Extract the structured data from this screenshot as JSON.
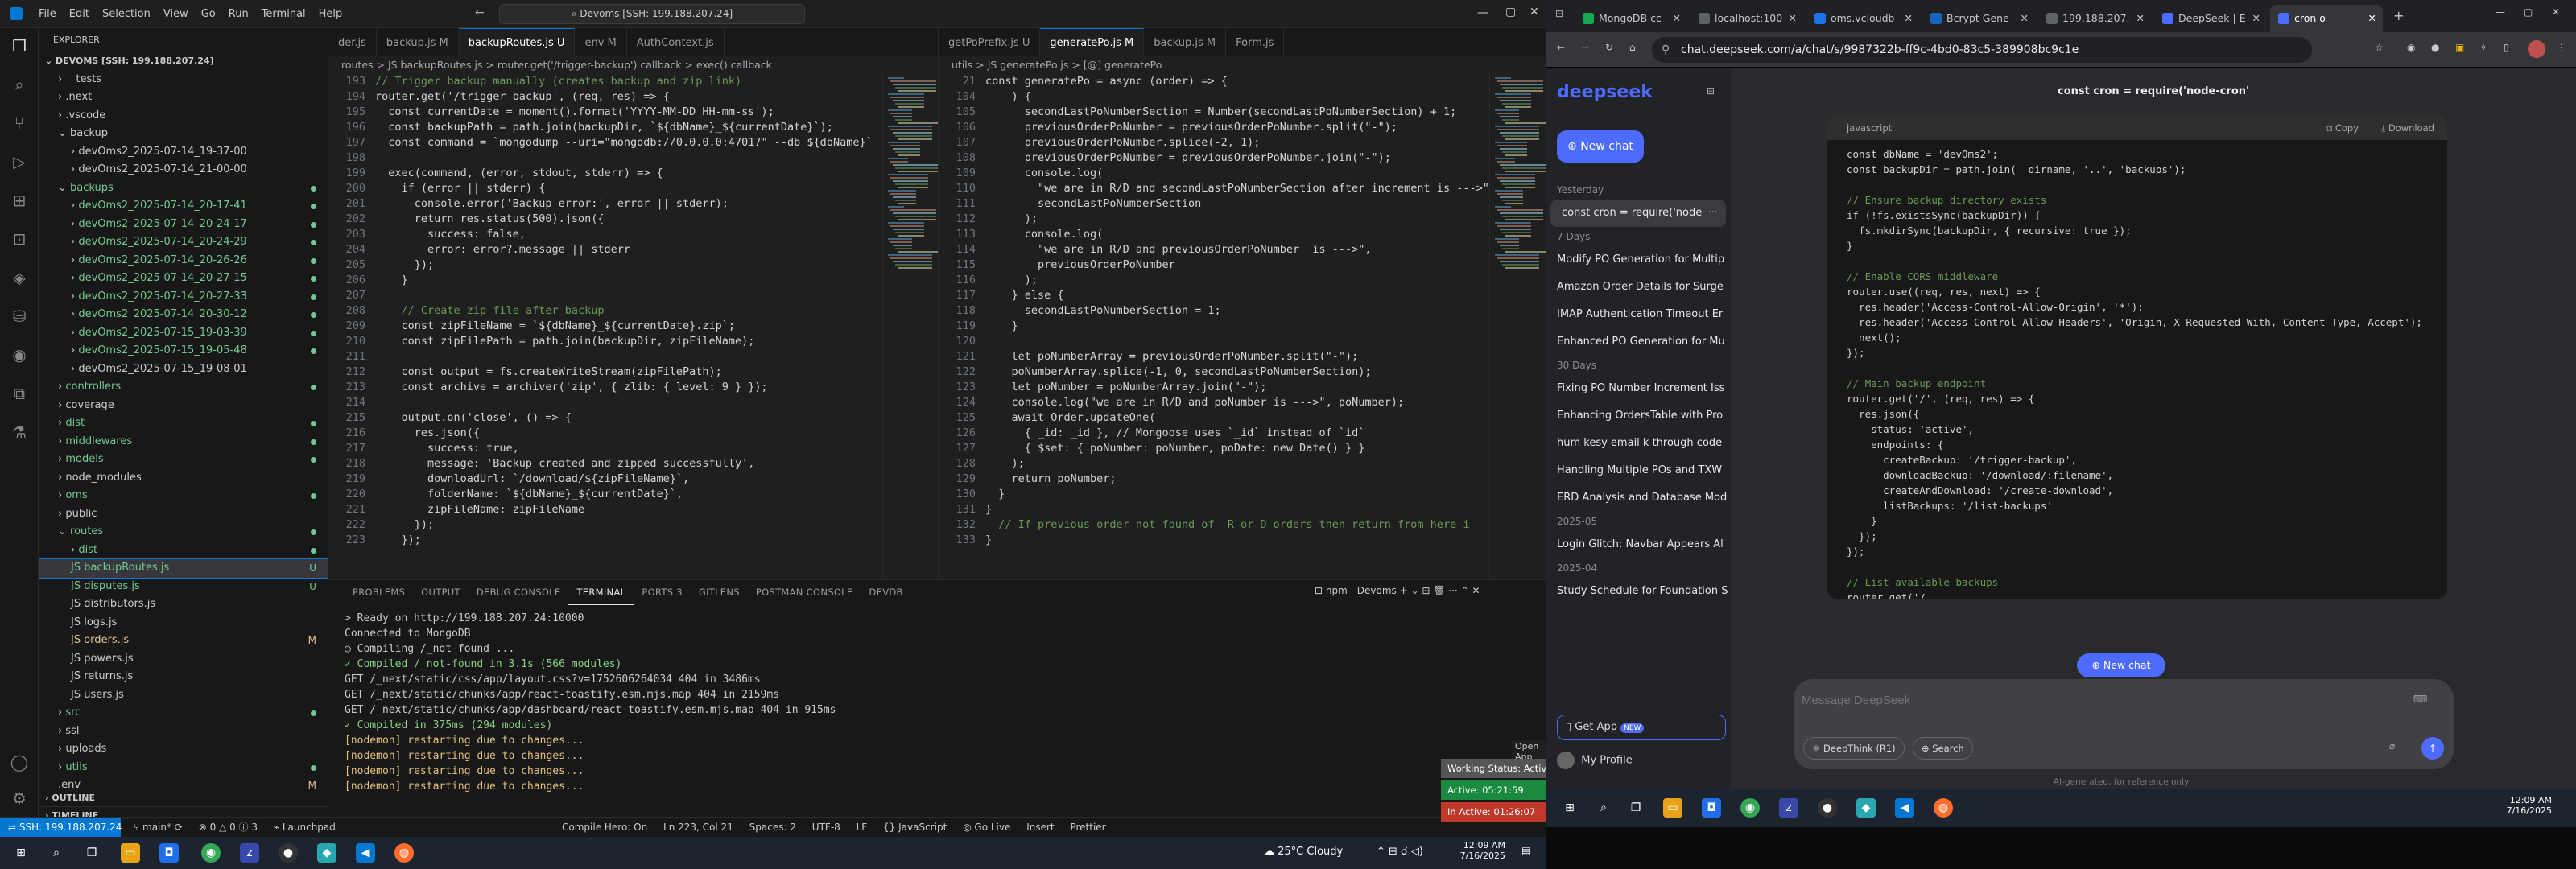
{
  "vscode": {
    "menu": [
      "File",
      "Edit",
      "Selection",
      "View",
      "Go",
      "Run",
      "Terminal",
      "Help"
    ],
    "command_center": "Devoms [SSH: 199.188.207.24]",
    "explorer_title": "EXPLORER",
    "workspace": "DEVOMS [SSH: 199.188.207.24]",
    "tree": [
      {
        "label": "__tests__",
        "indent": 1,
        "arrow": ">"
      },
      {
        "label": ".next",
        "indent": 1,
        "arrow": ">"
      },
      {
        "label": ".vscode",
        "indent": 1,
        "arrow": ">"
      },
      {
        "label": "backup",
        "indent": 1,
        "arrow": "v"
      },
      {
        "label": "devOms2_2025-07-14_19-37-00",
        "indent": 2,
        "arrow": ">"
      },
      {
        "label": "devOms2_2025-07-14_21-00-00",
        "indent": 2,
        "arrow": ">"
      },
      {
        "label": "backups",
        "indent": 1,
        "arrow": "v",
        "dot": true
      },
      {
        "label": "devOms2_2025-07-14_20-17-41",
        "indent": 2,
        "arrow": ">",
        "dot": true
      },
      {
        "label": "devOms2_2025-07-14_20-24-17",
        "indent": 2,
        "arrow": ">",
        "dot": true
      },
      {
        "label": "devOms2_2025-07-14_20-24-29",
        "indent": 2,
        "arrow": ">",
        "dot": true
      },
      {
        "label": "devOms2_2025-07-14_20-26-26",
        "indent": 2,
        "arrow": ">",
        "dot": true
      },
      {
        "label": "devOms2_2025-07-14_20-27-15",
        "indent": 2,
        "arrow": ">",
        "dot": true
      },
      {
        "label": "devOms2_2025-07-14_20-27-33",
        "indent": 2,
        "arrow": ">",
        "dot": true
      },
      {
        "label": "devOms2_2025-07-14_20-30-12",
        "indent": 2,
        "arrow": ">",
        "dot": true
      },
      {
        "label": "devOms2_2025-07-15_19-03-39",
        "indent": 2,
        "arrow": ">",
        "dot": true
      },
      {
        "label": "devOms2_2025-07-15_19-05-48",
        "indent": 2,
        "arrow": ">",
        "dot": true
      },
      {
        "label": "devOms2_2025-07-15_19-08-01",
        "indent": 2,
        "arrow": ">"
      },
      {
        "label": "controllers",
        "indent": 1,
        "arrow": ">",
        "dot": true
      },
      {
        "label": "coverage",
        "indent": 1,
        "arrow": ">"
      },
      {
        "label": "dist",
        "indent": 1,
        "arrow": ">",
        "dot": true
      },
      {
        "label": "middlewares",
        "indent": 1,
        "arrow": ">",
        "dot": true
      },
      {
        "label": "models",
        "indent": 1,
        "arrow": ">",
        "dot": true
      },
      {
        "label": "node_modules",
        "indent": 1,
        "arrow": ">"
      },
      {
        "label": "oms",
        "indent": 1,
        "arrow": ">",
        "dot": true
      },
      {
        "label": "public",
        "indent": 1,
        "arrow": ">"
      },
      {
        "label": "routes",
        "indent": 1,
        "arrow": "v",
        "dot": true
      },
      {
        "label": "dist",
        "indent": 2,
        "arrow": ">",
        "dot": true
      },
      {
        "label": "JS backupRoutes.js",
        "indent": 2,
        "arrow": "",
        "badge": "U",
        "sel": true
      },
      {
        "label": "JS disputes.js",
        "indent": 2,
        "arrow": "",
        "badge": "U"
      },
      {
        "label": "JS distributors.js",
        "indent": 2,
        "arrow": ""
      },
      {
        "label": "JS logs.js",
        "indent": 2,
        "arrow": ""
      },
      {
        "label": "JS orders.js",
        "indent": 2,
        "arrow": "",
        "badge": "M"
      },
      {
        "label": "JS powers.js",
        "indent": 2,
        "arrow": ""
      },
      {
        "label": "JS returns.js",
        "indent": 2,
        "arrow": ""
      },
      {
        "label": "JS users.js",
        "indent": 2,
        "arrow": ""
      },
      {
        "label": "src",
        "indent": 1,
        "arrow": ">",
        "dot": true
      },
      {
        "label": "ssl",
        "indent": 1,
        "arrow": ">"
      },
      {
        "label": "uploads",
        "indent": 1,
        "arrow": ">"
      },
      {
        "label": "utils",
        "indent": 1,
        "arrow": ">",
        "dot": true
      },
      {
        "label": ".env",
        "indent": 1,
        "arrow": "",
        "badge": "M"
      }
    ],
    "outline": "OUTLINE",
    "timeline": "TIMELINE",
    "left_tabs": [
      "der.js",
      "backup.js M",
      "backupRoutes.js U",
      "env M",
      "AuthContext.js"
    ],
    "left_crumbs": "routes > JS backupRoutes.js > router.get('/trigger-backup') callback > exec() callback",
    "left_code": [
      {
        "n": "193",
        "t": "// Trigger backup manually (creates backup and zip link)",
        "cls": "c"
      },
      {
        "n": "194",
        "t": "router.get('/trigger-backup', (req, res) => {"
      },
      {
        "n": "195",
        "t": "  const currentDate = moment().format('YYYY-MM-DD_HH-mm-ss');"
      },
      {
        "n": "196",
        "t": "  const backupPath = path.join(backupDir, `${dbName}_${currentDate}`);"
      },
      {
        "n": "197",
        "t": "  const command = `mongodump --uri=\"mongodb://0.0.0.0:47017\" --db ${dbName}`"
      },
      {
        "n": "198",
        "t": ""
      },
      {
        "n": "199",
        "t": "  exec(command, (error, stdout, stderr) => {"
      },
      {
        "n": "200",
        "t": "    if (error || stderr) {"
      },
      {
        "n": "201",
        "t": "      console.error('Backup error:', error || stderr);"
      },
      {
        "n": "202",
        "t": "      return res.status(500).json({"
      },
      {
        "n": "203",
        "t": "        success: false,"
      },
      {
        "n": "204",
        "t": "        error: error?.message || stderr"
      },
      {
        "n": "205",
        "t": "      });"
      },
      {
        "n": "206",
        "t": "    }"
      },
      {
        "n": "207",
        "t": ""
      },
      {
        "n": "208",
        "t": "    // Create zip file after backup",
        "cls": "c"
      },
      {
        "n": "209",
        "t": "    const zipFileName = `${dbName}_${currentDate}.zip`;"
      },
      {
        "n": "210",
        "t": "    const zipFilePath = path.join(backupDir, zipFileName);"
      },
      {
        "n": "211",
        "t": ""
      },
      {
        "n": "212",
        "t": "    const output = fs.createWriteStream(zipFilePath);"
      },
      {
        "n": "213",
        "t": "    const archive = archiver('zip', { zlib: { level: 9 } });"
      },
      {
        "n": "214",
        "t": ""
      },
      {
        "n": "215",
        "t": "    output.on('close', () => {"
      },
      {
        "n": "216",
        "t": "      res.json({"
      },
      {
        "n": "217",
        "t": "        success: true,"
      },
      {
        "n": "218",
        "t": "        message: 'Backup created and zipped successfully',"
      },
      {
        "n": "219",
        "t": "        downloadUrl: `/download/${zipFileName}`,"
      },
      {
        "n": "220",
        "t": "        folderName: `${dbName}_${currentDate}`,"
      },
      {
        "n": "221",
        "t": "        zipFileName: zipFileName"
      },
      {
        "n": "222",
        "t": "      });"
      },
      {
        "n": "223",
        "t": "    });"
      }
    ],
    "right_tabs": [
      "getPoPrefix.js U",
      "generatePo.js M",
      "backup.js M",
      "Form.js"
    ],
    "right_crumbs": "utils > JS generatePo.js > [@] generatePo",
    "right_code": [
      {
        "n": "21",
        "t": "const generatePo = async (order) => {"
      },
      {
        "n": "104",
        "t": "    ) {"
      },
      {
        "n": "105",
        "t": "      secondLastPoNumberSection = Number(secondLastPoNumberSection) + 1;"
      },
      {
        "n": "106",
        "t": "      previousOrderPoNumber = previousOrderPoNumber.split(\"-\");"
      },
      {
        "n": "107",
        "t": "      previousOrderPoNumber.splice(-2, 1);"
      },
      {
        "n": "108",
        "t": "      previousOrderPoNumber = previousOrderPoNumber.join(\"-\");"
      },
      {
        "n": "109",
        "t": "      console.log("
      },
      {
        "n": "110",
        "t": "        \"we are in R/D and secondLastPoNumberSection after increment is --->\","
      },
      {
        "n": "111",
        "t": "        secondLastPoNumberSection"
      },
      {
        "n": "112",
        "t": "      );"
      },
      {
        "n": "113",
        "t": "      console.log("
      },
      {
        "n": "114",
        "t": "        \"we are in R/D and previousOrderPoNumber  is --->\","
      },
      {
        "n": "115",
        "t": "        previousOrderPoNumber"
      },
      {
        "n": "116",
        "t": "      );"
      },
      {
        "n": "117",
        "t": "    } else {"
      },
      {
        "n": "118",
        "t": "      secondLastPoNumberSection = 1;"
      },
      {
        "n": "119",
        "t": "    }"
      },
      {
        "n": "120",
        "t": ""
      },
      {
        "n": "121",
        "t": "    let poNumberArray = previousOrderPoNumber.split(\"-\");"
      },
      {
        "n": "122",
        "t": "    poNumberArray.splice(-1, 0, secondLastPoNumberSection);"
      },
      {
        "n": "123",
        "t": "    let poNumber = poNumberArray.join(\"-\");"
      },
      {
        "n": "124",
        "t": "    console.log(\"we are in R/D and poNumber is --->\", poNumber);"
      },
      {
        "n": "125",
        "t": "    await Order.updateOne("
      },
      {
        "n": "126",
        "t": "      { _id: _id }, // Mongoose uses `_id` instead of `id`"
      },
      {
        "n": "127",
        "t": "      { $set: { poNumber: poNumber, poDate: new Date() } }"
      },
      {
        "n": "128",
        "t": "    );"
      },
      {
        "n": "129",
        "t": "    return poNumber;"
      },
      {
        "n": "130",
        "t": "  }"
      },
      {
        "n": "131",
        "t": "}"
      },
      {
        "n": "132",
        "t": "  // If previous order not found of -R or-D orders then return from here i",
        "cls": "c"
      },
      {
        "n": "133",
        "t": "}"
      }
    ],
    "panel_tabs": [
      "PROBLEMS",
      "OUTPUT",
      "DEBUG CONSOLE",
      "TERMINAL",
      "PORTS 3",
      "GITLENS",
      "POSTMAN CONSOLE",
      "DEVDB"
    ],
    "panel_active": "TERMINAL",
    "terminal_name": "npm - Devoms",
    "terminal": [
      {
        "t": "> Ready on http://199.188.207.24:10000",
        "cls": ""
      },
      {
        "t": "Connected to MongoDB",
        "cls": ""
      },
      {
        "t": "○ Compiling /_not-found ...",
        "cls": ""
      },
      {
        "t": "✓ Compiled /_not-found in 3.1s (566 modules)",
        "cls": ""
      },
      {
        "t": "GET /_next/static/css/app/layout.css?v=1752606264034 404 in 3486ms",
        "cls": ""
      },
      {
        "t": "GET /_next/static/chunks/app/react-toastify.esm.mjs.map 404 in 2159ms",
        "cls": ""
      },
      {
        "t": "GET /_next/static/chunks/app/dashboard/react-toastify.esm.mjs.map 404 in 915ms",
        "cls": ""
      },
      {
        "t": "✓ Compiled in 375ms (294 modules)",
        "cls": ""
      },
      {
        "t": "[nodemon] restarting due to changes...",
        "cls": "y"
      },
      {
        "t": "[nodemon] restarting due to changes...",
        "cls": "y"
      },
      {
        "t": "[nodemon] restarting due to changes...",
        "cls": "y"
      },
      {
        "t": "[nodemon] restarting due to changes...",
        "cls": "y"
      }
    ],
    "status": {
      "remote": "SSH: 199.188.207.24",
      "branch": "main*",
      "problems": "⊗ 0 △ 0 ⓘ 3",
      "launchpad": "Launchpad",
      "compile_hero": "Compile Hero: On",
      "cursor": "Ln 223, Col 21",
      "spaces": "Spaces: 2",
      "encoding": "UTF-8",
      "eol": "LF",
      "lang": "{} JavaScript",
      "golive": "Go Live",
      "insert": "Insert",
      "prettier": "Prettier"
    },
    "tracker": {
      "open_app": "Open App",
      "working": "Working Status: Active",
      "active": "Active: 05:21:59",
      "inactive": "In Active: 01:26:07"
    }
  },
  "taskbar_left": {
    "weather": "25°C Cloudy",
    "time": "12:09 AM",
    "date": "7/16/2025"
  },
  "browser": {
    "tabs": [
      {
        "label": "MongoDB cc",
        "color": "#13aa52"
      },
      {
        "label": "localhost:100",
        "color": "#5f6368"
      },
      {
        "label": "oms.vcloudb",
        "color": "#1a73e8"
      },
      {
        "label": "Bcrypt Gene",
        "color": "#1565c0"
      },
      {
        "label": "199.188.207.",
        "color": "#5f6368"
      },
      {
        "label": "DeepSeek | E",
        "color": "#4d6bfe"
      },
      {
        "label": "cron o",
        "color": "#4d6bfe"
      }
    ],
    "url": "chat.deepseek.com/a/chat/s/9987322b-ff9c-4bd0-83c5-389908bc9c1e",
    "logo": "deepseek",
    "new_chat": "New chat",
    "history": [
      {
        "sec": "Yesterday"
      },
      {
        "item": "const cron = require('node",
        "active": true
      },
      {
        "sec": "7 Days"
      },
      {
        "item": "Modify PO Generation for Multip"
      },
      {
        "item": "Amazon Order Details for Surge"
      },
      {
        "item": "IMAP Authentication Timeout Er"
      },
      {
        "item": "Enhanced PO Generation for Mu"
      },
      {
        "sec": "30 Days"
      },
      {
        "item": "Fixing PO Number Increment Iss"
      },
      {
        "item": "Enhancing OrdersTable with Pro"
      },
      {
        "item": "hum kesy email k through code"
      },
      {
        "item": "Handling Multiple POs and TXW"
      },
      {
        "item": "ERD Analysis and Database Mod"
      },
      {
        "sec": "2025-05"
      },
      {
        "item": "Login Glitch: Navbar Appears Al"
      },
      {
        "sec": "2025-04"
      },
      {
        "item": "Study Schedule for Foundation S"
      }
    ],
    "get_app": "Get App",
    "new_badge": "NEW",
    "profile": "My Profile",
    "chat_title": "const cron = require('node-cron'",
    "code_lang": "javascript",
    "copy": "Copy",
    "download": "Download",
    "code": [
      {
        "t": "const dbName = 'devOms2';"
      },
      {
        "t": "const backupDir = path.join(__dirname, '..', 'backups');"
      },
      {
        "t": ""
      },
      {
        "t": "// Ensure backup directory exists",
        "cls": "c"
      },
      {
        "t": "if (!fs.existsSync(backupDir)) {"
      },
      {
        "t": "  fs.mkdirSync(backupDir, { recursive: true });"
      },
      {
        "t": "}"
      },
      {
        "t": ""
      },
      {
        "t": "// Enable CORS middleware",
        "cls": "c"
      },
      {
        "t": "router.use((req, res, next) => {"
      },
      {
        "t": "  res.header('Access-Control-Allow-Origin', '*');"
      },
      {
        "t": "  res.header('Access-Control-Allow-Headers', 'Origin, X-Requested-With, Content-Type, Accept');"
      },
      {
        "t": "  next();"
      },
      {
        "t": "});"
      },
      {
        "t": ""
      },
      {
        "t": "// Main backup endpoint",
        "cls": "c"
      },
      {
        "t": "router.get('/', (req, res) => {"
      },
      {
        "t": "  res.json({"
      },
      {
        "t": "    status: 'active',"
      },
      {
        "t": "    endpoints: {"
      },
      {
        "t": "      createBackup: '/trigger-backup',"
      },
      {
        "t": "      downloadBackup: '/download/:filename',"
      },
      {
        "t": "      createAndDownload: '/create-download',"
      },
      {
        "t": "      listBackups: '/list-backups'"
      },
      {
        "t": "    }"
      },
      {
        "t": "  });"
      },
      {
        "t": "});"
      },
      {
        "t": ""
      },
      {
        "t": "// List available backups",
        "cls": "c"
      },
      {
        "t": "router.get('/"
      }
    ],
    "new_chat_pill": "New chat",
    "placeholder": "Message DeepSeek",
    "deepthink": "DeepThink (R1)",
    "search": "Search",
    "disclaimer": "AI-generated, for reference only"
  },
  "taskbar_right": {
    "time": "12:09 AM",
    "date": "7/16/2025"
  }
}
